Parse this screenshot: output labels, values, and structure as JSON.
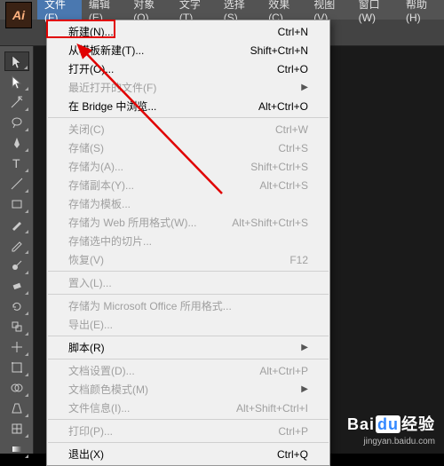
{
  "app_icon": "Ai",
  "menubar": {
    "items": [
      {
        "label": "文件(F)"
      },
      {
        "label": "编辑(E)"
      },
      {
        "label": "对象(O)"
      },
      {
        "label": "文字(T)"
      },
      {
        "label": "选择(S)"
      },
      {
        "label": "效果(C)"
      },
      {
        "label": "视图(V)"
      },
      {
        "label": "窗口(W)"
      },
      {
        "label": "帮助(H)"
      }
    ]
  },
  "dropdown": {
    "groups": [
      [
        {
          "label": "新建(N)...",
          "shortcut": "Ctrl+N"
        },
        {
          "label": "从模板新建(T)...",
          "shortcut": "Shift+Ctrl+N"
        },
        {
          "label": "打开(O)...",
          "shortcut": "Ctrl+O"
        },
        {
          "label": "最近打开的文件(F)",
          "shortcut": "",
          "submenu": true,
          "disabled": true
        },
        {
          "label": "在 Bridge 中浏览...",
          "shortcut": "Alt+Ctrl+O"
        }
      ],
      [
        {
          "label": "关闭(C)",
          "shortcut": "Ctrl+W",
          "disabled": true
        },
        {
          "label": "存储(S)",
          "shortcut": "Ctrl+S",
          "disabled": true
        },
        {
          "label": "存储为(A)...",
          "shortcut": "Shift+Ctrl+S",
          "disabled": true
        },
        {
          "label": "存储副本(Y)...",
          "shortcut": "Alt+Ctrl+S",
          "disabled": true
        },
        {
          "label": "存储为模板...",
          "shortcut": "",
          "disabled": true
        },
        {
          "label": "存储为 Web 所用格式(W)...",
          "shortcut": "Alt+Shift+Ctrl+S",
          "disabled": true
        },
        {
          "label": "存储选中的切片...",
          "shortcut": "",
          "disabled": true
        },
        {
          "label": "恢复(V)",
          "shortcut": "F12",
          "disabled": true
        }
      ],
      [
        {
          "label": "置入(L)...",
          "shortcut": "",
          "disabled": true
        }
      ],
      [
        {
          "label": "存储为 Microsoft Office 所用格式...",
          "shortcut": "",
          "disabled": true
        },
        {
          "label": "导出(E)...",
          "shortcut": "",
          "disabled": true
        }
      ],
      [
        {
          "label": "脚本(R)",
          "shortcut": "",
          "submenu": true
        }
      ],
      [
        {
          "label": "文档设置(D)...",
          "shortcut": "Alt+Ctrl+P",
          "disabled": true
        },
        {
          "label": "文档颜色模式(M)",
          "shortcut": "",
          "submenu": true,
          "disabled": true
        },
        {
          "label": "文件信息(I)...",
          "shortcut": "Alt+Shift+Ctrl+I",
          "disabled": true
        }
      ],
      [
        {
          "label": "打印(P)...",
          "shortcut": "Ctrl+P",
          "disabled": true
        }
      ],
      [
        {
          "label": "退出(X)",
          "shortcut": "Ctrl+Q"
        }
      ]
    ]
  },
  "tools": [
    "selection",
    "direct-selection",
    "magic-wand",
    "lasso",
    "pen",
    "type",
    "line",
    "rectangle",
    "paintbrush",
    "pencil",
    "blob-brush",
    "eraser",
    "rotate",
    "scale",
    "width",
    "free-transform",
    "shape-builder",
    "perspective",
    "mesh",
    "gradient"
  ],
  "watermark": {
    "brand_a": "Bai",
    "brand_b": "du",
    "brand_c": "经验",
    "url": "jingyan.baidu.com"
  }
}
